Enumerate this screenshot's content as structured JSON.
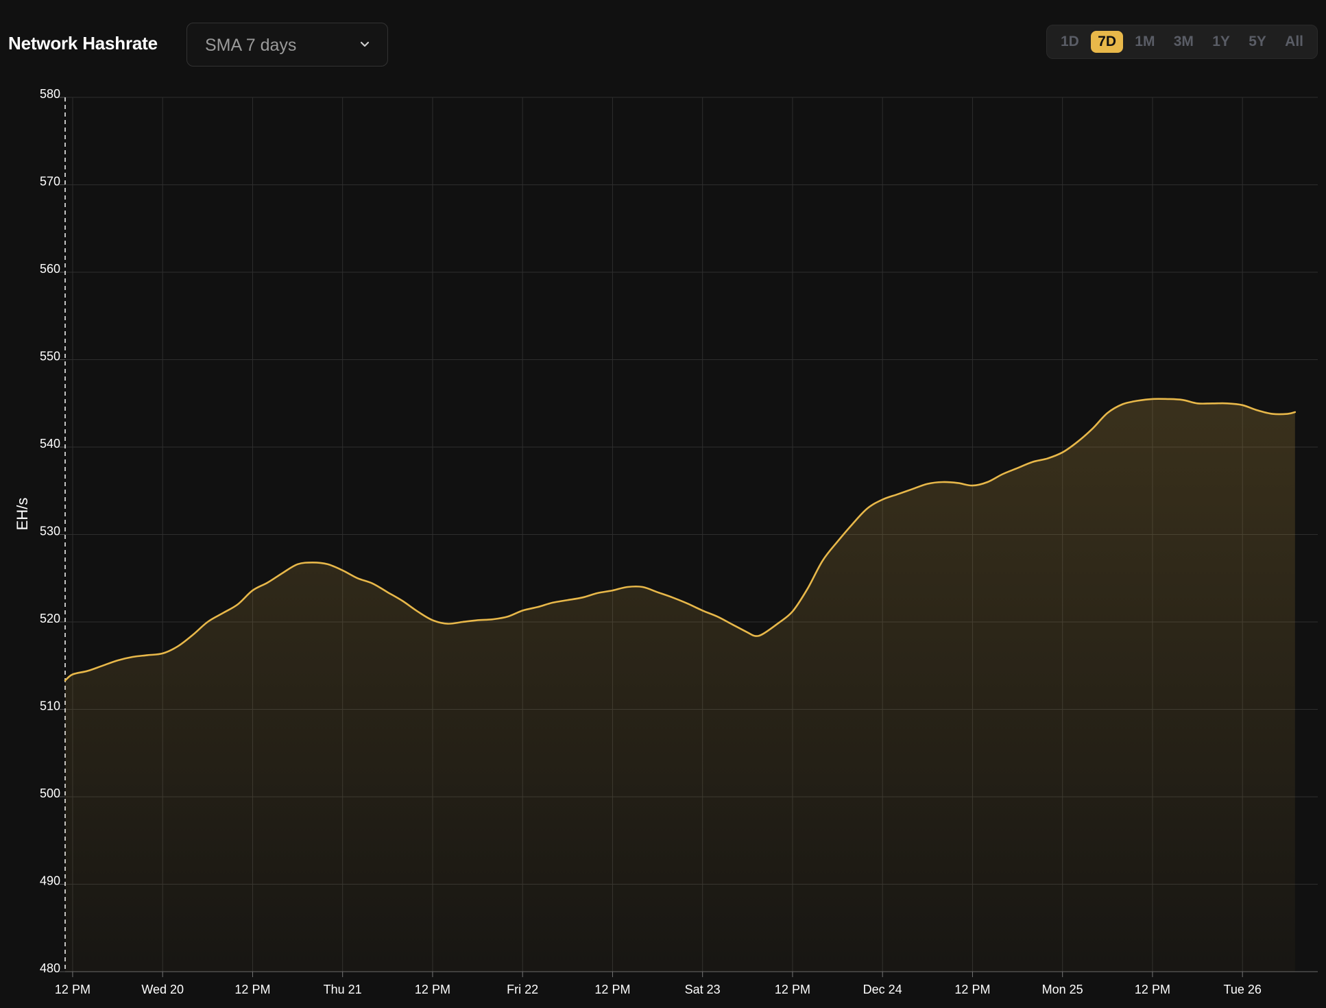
{
  "header": {
    "title": "Network Hashrate",
    "select_value": "SMA 7 days",
    "ranges": [
      "1D",
      "7D",
      "1M",
      "3M",
      "1Y",
      "5Y",
      "All"
    ],
    "active_range": "7D"
  },
  "colors": {
    "line": "#e8b84a",
    "background": "#111111",
    "grid": "#2e2e2e"
  },
  "chart_data": {
    "type": "area",
    "title": "Network Hashrate",
    "ylabel": "EH/s",
    "xlabel": "",
    "ylim": [
      480,
      580
    ],
    "yticks": [
      480,
      490,
      500,
      510,
      520,
      530,
      540,
      550,
      560,
      570,
      580
    ],
    "xlim": [
      "Dec 19 11:00",
      "Dec 26 19:00"
    ],
    "xticks": [
      {
        "label": "12 PM",
        "x": "Dec 19 12:00"
      },
      {
        "label": "Wed 20",
        "x": "Dec 20 00:00"
      },
      {
        "label": "12 PM",
        "x": "Dec 20 12:00"
      },
      {
        "label": "Thu 21",
        "x": "Dec 21 00:00"
      },
      {
        "label": "12 PM",
        "x": "Dec 21 12:00"
      },
      {
        "label": "Fri 22",
        "x": "Dec 22 00:00"
      },
      {
        "label": "12 PM",
        "x": "Dec 22 12:00"
      },
      {
        "label": "Sat 23",
        "x": "Dec 23 00:00"
      },
      {
        "label": "12 PM",
        "x": "Dec 23 12:00"
      },
      {
        "label": "Dec 24",
        "x": "Dec 24 00:00"
      },
      {
        "label": "12 PM",
        "x": "Dec 24 12:00"
      },
      {
        "label": "Mon 25",
        "x": "Dec 25 00:00"
      },
      {
        "label": "12 PM",
        "x": "Dec 25 12:00"
      },
      {
        "label": "Tue 26",
        "x": "Dec 26 00:00"
      }
    ],
    "grid": true,
    "series": [
      {
        "points": [
          [
            "Dec 19 11:00",
            513.3
          ],
          [
            "Dec 19 12:00",
            514.0
          ],
          [
            "Dec 19 14:00",
            514.4
          ],
          [
            "Dec 19 16:00",
            515.0
          ],
          [
            "Dec 19 18:00",
            515.6
          ],
          [
            "Dec 19 20:00",
            516.0
          ],
          [
            "Dec 19 22:00",
            516.2
          ],
          [
            "Dec 20 00:00",
            516.4
          ],
          [
            "Dec 20 02:00",
            517.2
          ],
          [
            "Dec 20 04:00",
            518.5
          ],
          [
            "Dec 20 06:00",
            520.0
          ],
          [
            "Dec 20 08:00",
            521.0
          ],
          [
            "Dec 20 10:00",
            522.0
          ],
          [
            "Dec 20 12:00",
            523.6
          ],
          [
            "Dec 20 14:00",
            524.5
          ],
          [
            "Dec 20 16:00",
            525.6
          ],
          [
            "Dec 20 18:00",
            526.6
          ],
          [
            "Dec 20 20:00",
            526.8
          ],
          [
            "Dec 20 22:00",
            526.6
          ],
          [
            "Dec 21 00:00",
            525.9
          ],
          [
            "Dec 21 02:00",
            525.0
          ],
          [
            "Dec 21 04:00",
            524.4
          ],
          [
            "Dec 21 06:00",
            523.4
          ],
          [
            "Dec 21 08:00",
            522.4
          ],
          [
            "Dec 21 10:00",
            521.2
          ],
          [
            "Dec 21 12:00",
            520.2
          ],
          [
            "Dec 21 14:00",
            519.8
          ],
          [
            "Dec 21 16:00",
            520.0
          ],
          [
            "Dec 21 18:00",
            520.2
          ],
          [
            "Dec 21 20:00",
            520.3
          ],
          [
            "Dec 21 22:00",
            520.6
          ],
          [
            "Dec 22 00:00",
            521.3
          ],
          [
            "Dec 22 02:00",
            521.7
          ],
          [
            "Dec 22 04:00",
            522.2
          ],
          [
            "Dec 22 06:00",
            522.5
          ],
          [
            "Dec 22 08:00",
            522.8
          ],
          [
            "Dec 22 10:00",
            523.3
          ],
          [
            "Dec 22 12:00",
            523.6
          ],
          [
            "Dec 22 14:00",
            524.0
          ],
          [
            "Dec 22 16:00",
            524.0
          ],
          [
            "Dec 22 18:00",
            523.4
          ],
          [
            "Dec 22 20:00",
            522.8
          ],
          [
            "Dec 22 22:00",
            522.1
          ],
          [
            "Dec 23 00:00",
            521.3
          ],
          [
            "Dec 23 02:00",
            520.6
          ],
          [
            "Dec 23 04:00",
            519.7
          ],
          [
            "Dec 23 06:00",
            518.8
          ],
          [
            "Dec 23 07:00",
            518.4
          ],
          [
            "Dec 23 08:00",
            518.6
          ],
          [
            "Dec 23 10:00",
            519.8
          ],
          [
            "Dec 23 12:00",
            521.2
          ],
          [
            "Dec 23 14:00",
            523.8
          ],
          [
            "Dec 23 16:00",
            527.0
          ],
          [
            "Dec 23 18:00",
            529.2
          ],
          [
            "Dec 23 20:00",
            531.2
          ],
          [
            "Dec 23 22:00",
            533.0
          ],
          [
            "Dec 24 00:00",
            534.0
          ],
          [
            "Dec 24 02:00",
            534.6
          ],
          [
            "Dec 24 04:00",
            535.2
          ],
          [
            "Dec 24 06:00",
            535.8
          ],
          [
            "Dec 24 08:00",
            536.0
          ],
          [
            "Dec 24 10:00",
            535.9
          ],
          [
            "Dec 24 12:00",
            535.6
          ],
          [
            "Dec 24 14:00",
            536.0
          ],
          [
            "Dec 24 16:00",
            536.9
          ],
          [
            "Dec 24 18:00",
            537.6
          ],
          [
            "Dec 24 20:00",
            538.3
          ],
          [
            "Dec 24 22:00",
            538.7
          ],
          [
            "Dec 25 00:00",
            539.4
          ],
          [
            "Dec 25 02:00",
            540.6
          ],
          [
            "Dec 25 04:00",
            542.1
          ],
          [
            "Dec 25 06:00",
            543.9
          ],
          [
            "Dec 25 08:00",
            544.9
          ],
          [
            "Dec 25 10:00",
            545.3
          ],
          [
            "Dec 25 12:00",
            545.5
          ],
          [
            "Dec 25 14:00",
            545.5
          ],
          [
            "Dec 25 16:00",
            545.4
          ],
          [
            "Dec 25 18:00",
            545.0
          ],
          [
            "Dec 25 20:00",
            545.0
          ],
          [
            "Dec 25 22:00",
            545.0
          ],
          [
            "Dec 26 00:00",
            544.8
          ],
          [
            "Dec 26 02:00",
            544.2
          ],
          [
            "Dec 26 04:00",
            543.8
          ],
          [
            "Dec 26 06:00",
            543.8
          ],
          [
            "Dec 26 07:00",
            544.0
          ]
        ]
      }
    ]
  }
}
